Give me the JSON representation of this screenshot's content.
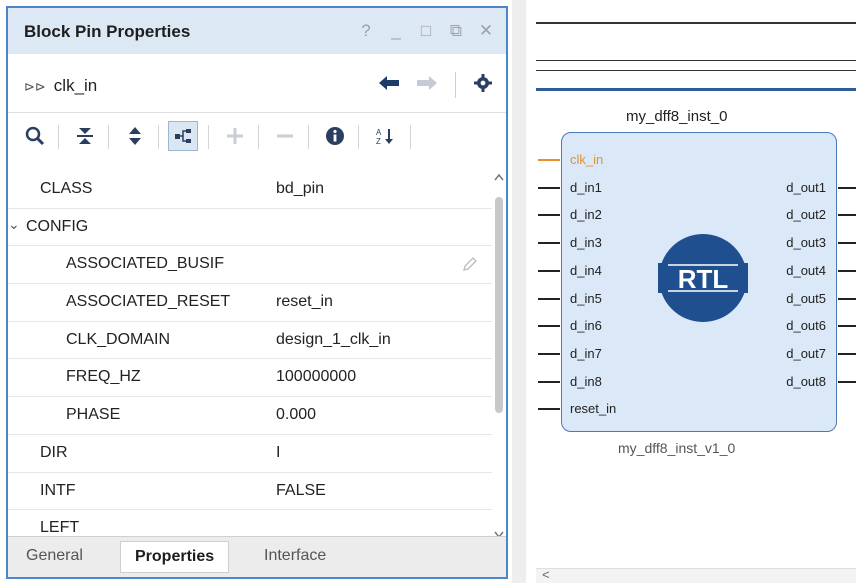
{
  "panel": {
    "title": "Block Pin Properties",
    "window_buttons": [
      "?",
      "_",
      "□",
      "⧉",
      "✕"
    ],
    "object_name": "clk_in"
  },
  "colors": {
    "accent": "#4a86c8",
    "titlebar": "#dde8f5",
    "block_fill": "#dae8f8",
    "block_border": "#4a7bb7",
    "rtl_logo": "#1f4f8f",
    "clk_pin": "#e8902a"
  },
  "properties": [
    {
      "name": "CLASS",
      "value": "bd_pin",
      "indent": 0
    },
    {
      "name": "CONFIG",
      "value": "",
      "indent": 0,
      "expander": "⌄"
    },
    {
      "name": "ASSOCIATED_BUSIF",
      "value": "",
      "indent": 1,
      "edit_icon": "pencil-icon"
    },
    {
      "name": "ASSOCIATED_RESET",
      "value": "reset_in",
      "indent": 1
    },
    {
      "name": "CLK_DOMAIN",
      "value": "design_1_clk_in",
      "indent": 1
    },
    {
      "name": "FREQ_HZ",
      "value": "100000000",
      "indent": 1
    },
    {
      "name": "PHASE",
      "value": "0.000",
      "indent": 1
    },
    {
      "name": "DIR",
      "value": "I",
      "indent": 0
    },
    {
      "name": "INTF",
      "value": "FALSE",
      "indent": 0
    },
    {
      "name": "LEFT",
      "value": "",
      "indent": 0
    }
  ],
  "tabs": [
    {
      "label": "General",
      "active": false
    },
    {
      "label": "Properties",
      "active": true
    },
    {
      "label": "Interface",
      "active": false
    }
  ],
  "canvas": {
    "instance_name": "my_dff8_inst_0",
    "module_name": "my_dff8_inst_v1_0",
    "logo_text": "RTL",
    "inputs": [
      "clk_in",
      "d_in1",
      "d_in2",
      "d_in3",
      "d_in4",
      "d_in5",
      "d_in6",
      "d_in7",
      "d_in8",
      "reset_in"
    ],
    "outputs": [
      "d_out1",
      "d_out2",
      "d_out3",
      "d_out4",
      "d_out5",
      "d_out6",
      "d_out7",
      "d_out8"
    ],
    "scroll_left": "<"
  }
}
